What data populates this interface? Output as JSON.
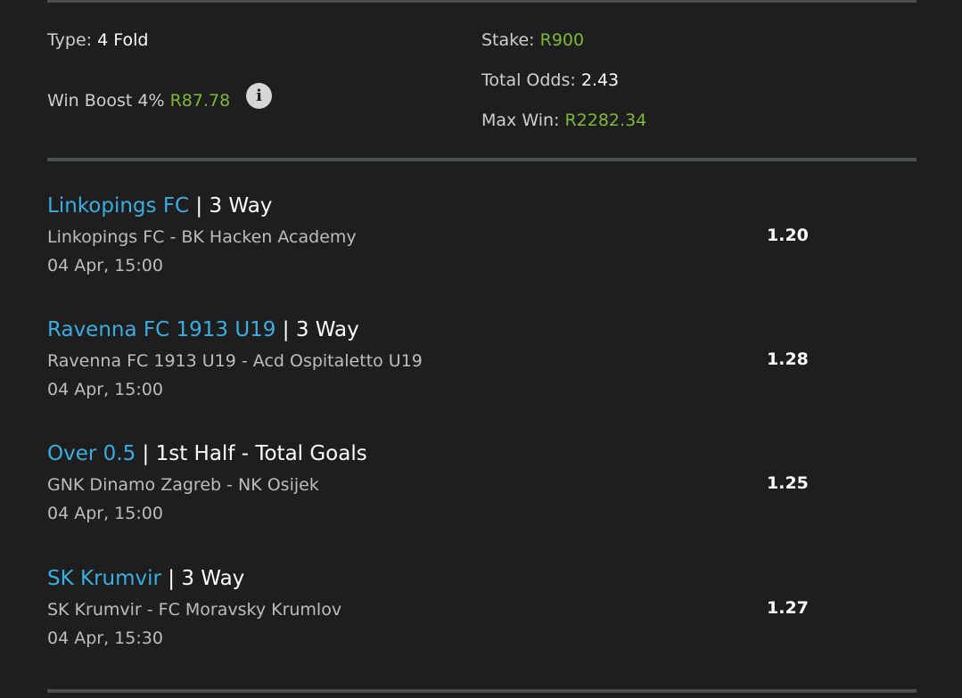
{
  "summary": {
    "type_label": "Type:",
    "type_value": "4 Fold",
    "boost_label": "Win Boost 4%",
    "boost_value": "R87.78",
    "info_icon": "info-icon",
    "stake_label": "Stake:",
    "stake_value": "R900",
    "total_odds_label": "Total Odds:",
    "total_odds_value": "2.43",
    "max_win_label": "Max Win:",
    "max_win_value": "R2282.34"
  },
  "selections": [
    {
      "pick": "Linkopings FC",
      "separator": "|",
      "market": "3 Way",
      "teams": "Linkopings FC - BK Hacken Academy",
      "time": "04 Apr, 15:00",
      "odds": "1.20"
    },
    {
      "pick": "Ravenna FC 1913 U19",
      "separator": "|",
      "market": "3 Way",
      "teams": "Ravenna FC 1913 U19 - Acd Ospitaletto U19",
      "time": "04 Apr, 15:00",
      "odds": "1.28"
    },
    {
      "pick": "Over 0.5",
      "separator": "|",
      "market": "1st Half - Total Goals",
      "teams": "GNK Dinamo Zagreb - NK Osijek",
      "time": "04 Apr, 15:00",
      "odds": "1.25"
    },
    {
      "pick": "SK Krumvir",
      "separator": "|",
      "market": "3 Way",
      "teams": "SK Krumvir - FC Moravsky Krumlov",
      "time": "04 Apr, 15:30",
      "odds": "1.27"
    }
  ],
  "colors": {
    "background": "#1e1e1e",
    "pick_blue": "#3aaee0",
    "money_green": "#7fb833",
    "divider": "#4a4f52"
  }
}
